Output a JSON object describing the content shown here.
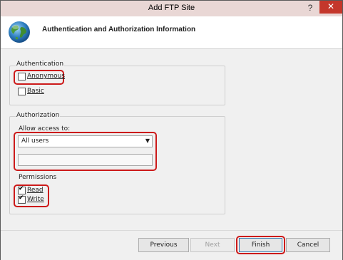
{
  "window": {
    "title": "Add FTP Site",
    "help_glyph": "?",
    "close_glyph": "✕"
  },
  "header": {
    "title": "Authentication and Authorization Information",
    "icon": "globe-icon"
  },
  "authentication": {
    "label": "Authentication",
    "anonymous": {
      "label": "Anonymous",
      "checked": false
    },
    "basic": {
      "label": "Basic",
      "checked": false
    }
  },
  "authorization": {
    "label": "Authorization",
    "allow_access_label": "Allow access to:",
    "allow_access_value": "All users",
    "users_value": "",
    "permissions_label": "Permissions",
    "read": {
      "label": "Read",
      "checked": true
    },
    "write": {
      "label": "Write",
      "checked": true
    }
  },
  "buttons": {
    "previous": "Previous",
    "next": "Next",
    "finish": "Finish",
    "cancel": "Cancel"
  },
  "colors": {
    "highlight": "#cc1a1a",
    "close_button": "#c4372b",
    "titlebar": "#e9d7d5"
  }
}
